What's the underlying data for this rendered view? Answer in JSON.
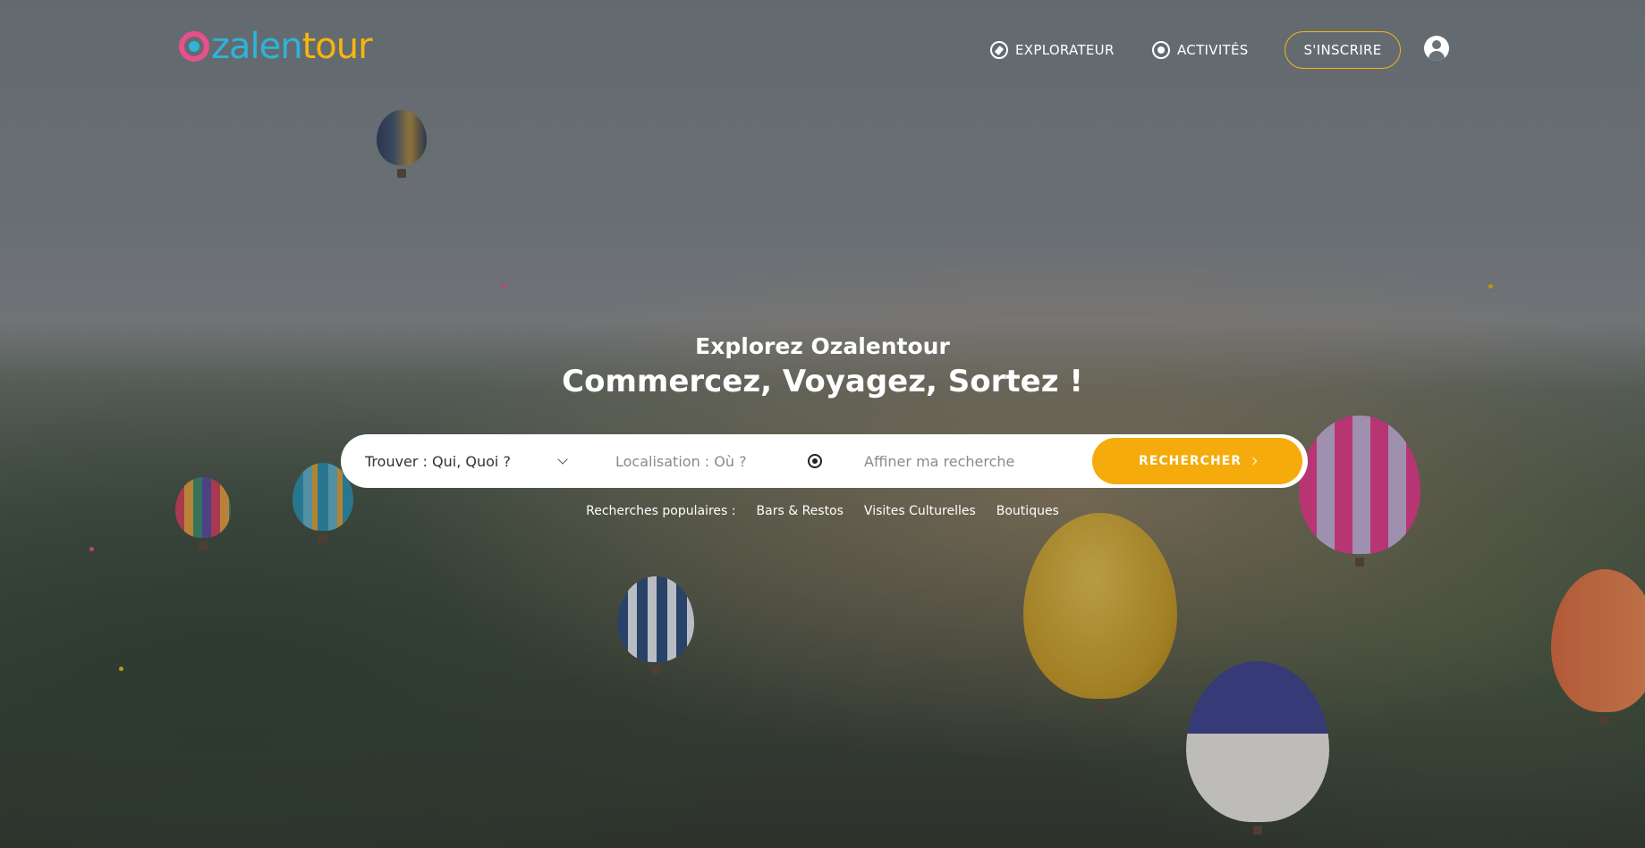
{
  "brand": {
    "logo_part1": "zalen",
    "logo_part2": "tour",
    "colors": {
      "pink": "#e84f8c",
      "blue": "#2fb3d8",
      "yellow": "#f5b60d",
      "accent": "#f5ab0b"
    }
  },
  "nav": {
    "items": [
      {
        "label": "EXPLORATEUR",
        "icon": "compass-icon"
      },
      {
        "label": "ACTIVITÉS",
        "icon": "target-icon"
      }
    ],
    "signup_label": "S'INSCRIRE",
    "user_icon": "user-icon"
  },
  "hero": {
    "title": "Explorez Ozalentour",
    "subtitle": "Commercez, Voyagez, Sortez !"
  },
  "search": {
    "what_label": "Trouver : Qui, Quoi ?",
    "location_placeholder": "Localisation : Où ?",
    "refine_placeholder": "Affiner ma recherche",
    "button_label": "RECHERCHER"
  },
  "popular": {
    "label": "Recherches populaires :",
    "links": [
      "Bars & Restos",
      "Visites Culturelles",
      "Boutiques"
    ]
  }
}
